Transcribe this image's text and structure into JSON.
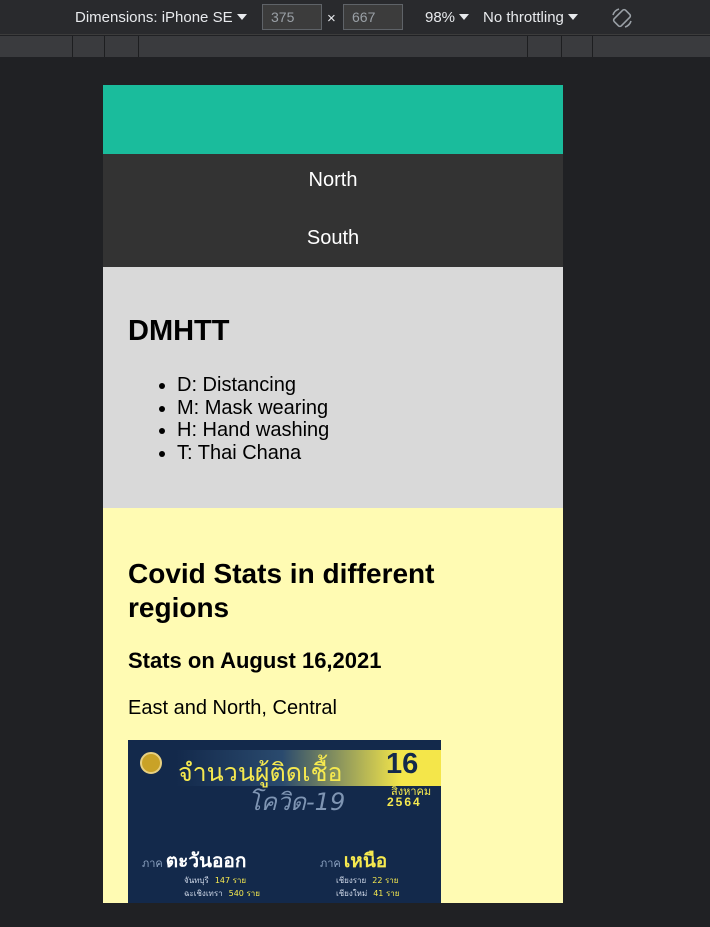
{
  "devtools": {
    "dimensions_label": "Dimensions: iPhone SE",
    "width_value": "375",
    "height_value": "667",
    "times": "×",
    "zoom": "98%",
    "throttling": "No throttling"
  },
  "page": {
    "nav": [
      "North",
      "South"
    ],
    "dmhtt": {
      "heading": "DMHTT",
      "items": [
        "D: Distancing",
        "M: Mask wearing",
        "H: Hand washing",
        "T: Thai Chana"
      ]
    },
    "stats": {
      "heading": "Covid Stats in different regions",
      "subheading": "Stats on August 16,2021",
      "regions_text": "East and North, Central"
    },
    "infographic": {
      "title": "จำนวนผู้ติดเชื้อ",
      "day": "16",
      "subtitle": "โควิด-19",
      "month": "สิงหาคม",
      "year": "2564",
      "region_prefix": "ภาค",
      "east_name": "ตะวันออก",
      "north_name": "เหนือ",
      "east_rows": [
        {
          "province": "จันทบุรี",
          "count": "147 ราย"
        },
        {
          "province": "ฉะเชิงเทรา",
          "count": "540 ราย"
        }
      ],
      "north_rows": [
        {
          "province": "เชียงราย",
          "count": "22 ราย"
        },
        {
          "province": "เชียงใหม่",
          "count": "41 ราย"
        }
      ]
    }
  }
}
